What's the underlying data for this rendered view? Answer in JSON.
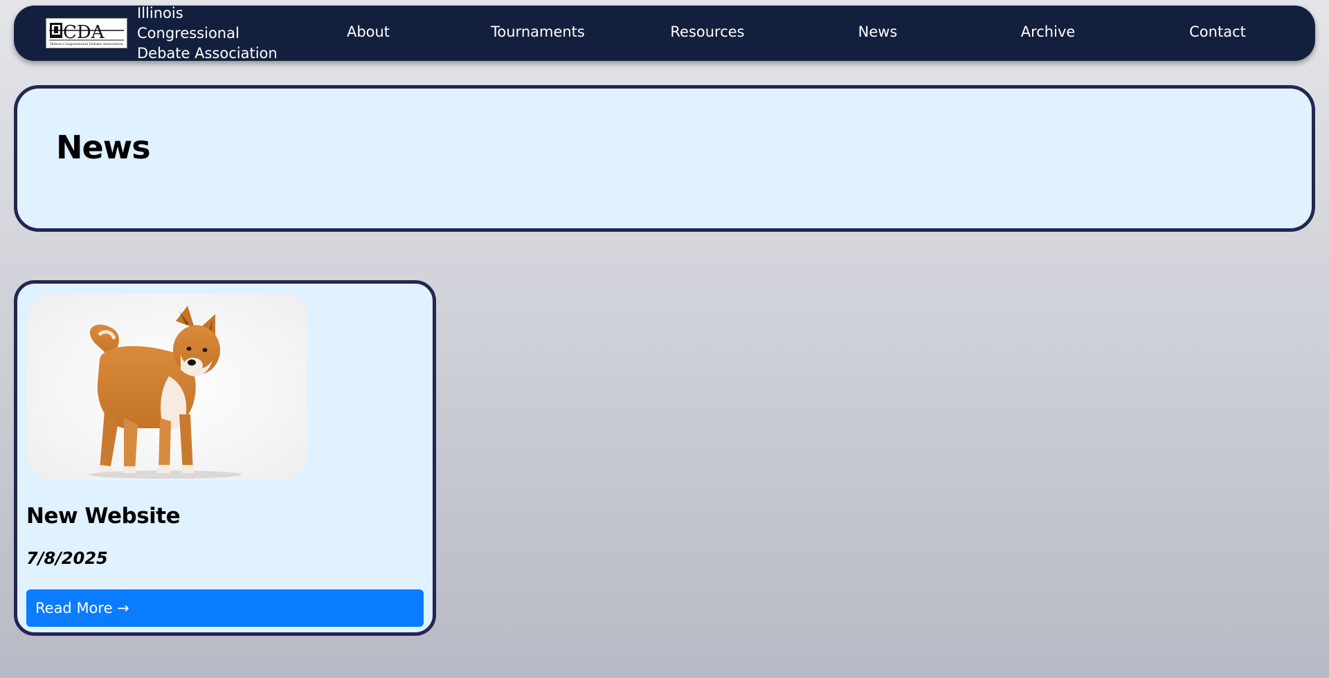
{
  "brand": {
    "name_line1": "Illinois Congressional",
    "name_line2": "Debate Association",
    "logo_text": "ICDA",
    "logo_subtext": "Illinois Congressional Debate Association"
  },
  "nav": {
    "items": [
      {
        "label": "About"
      },
      {
        "label": "Tournaments"
      },
      {
        "label": "Resources"
      },
      {
        "label": "News"
      },
      {
        "label": "Archive"
      },
      {
        "label": "Contact"
      }
    ]
  },
  "header": {
    "title": "News"
  },
  "news": {
    "cards": [
      {
        "image": "shiba-inu-dog-photo",
        "title": "New Website",
        "date": "7/8/2025",
        "button_label": "Read More →"
      }
    ]
  },
  "colors": {
    "navbar_bg": "#13203d",
    "panel_bg": "#e0f1ff",
    "panel_border": "#232650",
    "button_bg": "#0a7cff"
  }
}
